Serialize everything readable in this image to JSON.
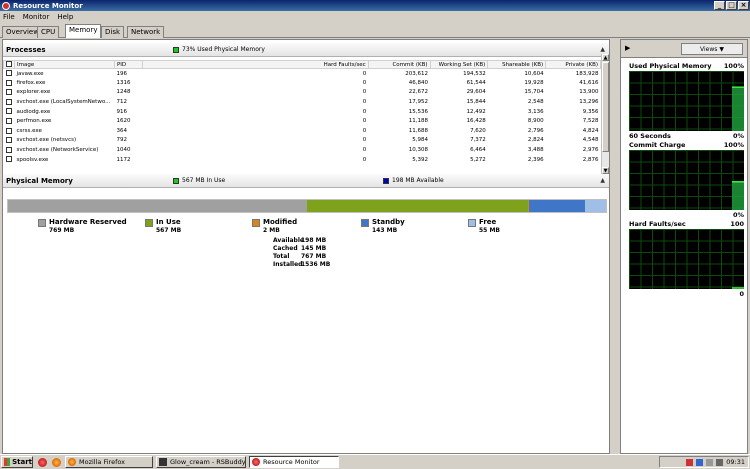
{
  "window": {
    "title": "Resource Monitor"
  },
  "menu": [
    "File",
    "Monitor",
    "Help"
  ],
  "tabs": [
    "Overview",
    "CPU",
    "Memory",
    "Disk",
    "Network"
  ],
  "active_tab": "Memory",
  "processes": {
    "label": "Processes",
    "legend": "73% Used Physical Memory",
    "legend_color": "#21c721",
    "columns": [
      "Image",
      "PID",
      "Hard Faults/sec",
      "Commit (KB)",
      "Working Set (KB)",
      "Shareable (KB)",
      "Private (KB)"
    ],
    "rows": [
      [
        "javaw.exe",
        "196",
        "0",
        "203,612",
        "194,532",
        "10,604",
        "183,928"
      ],
      [
        "firefox.exe",
        "1316",
        "0",
        "46,840",
        "61,544",
        "19,928",
        "41,616"
      ],
      [
        "explorer.exe",
        "1248",
        "0",
        "22,672",
        "29,604",
        "15,704",
        "13,900"
      ],
      [
        "svchost.exe (LocalSystemNetwo...",
        "712",
        "0",
        "17,952",
        "15,844",
        "2,548",
        "13,296"
      ],
      [
        "audiodg.exe",
        "916",
        "0",
        "15,536",
        "12,492",
        "3,136",
        "9,356"
      ],
      [
        "perfmon.exe",
        "1620",
        "0",
        "11,188",
        "16,428",
        "8,900",
        "7,528"
      ],
      [
        "csrss.exe",
        "364",
        "0",
        "11,688",
        "7,620",
        "2,796",
        "4,824"
      ],
      [
        "svchost.exe (netsvcs)",
        "792",
        "0",
        "5,984",
        "7,372",
        "2,824",
        "4,548"
      ],
      [
        "svchost.exe (NetworkService)",
        "1040",
        "0",
        "10,308",
        "6,464",
        "3,488",
        "2,976"
      ],
      [
        "spoolsv.exe",
        "1172",
        "0",
        "5,392",
        "5,272",
        "2,396",
        "2,876"
      ]
    ]
  },
  "physical_memory": {
    "label": "Physical Memory",
    "inuse_legend": "567 MB In Use",
    "inuse_color": "#21c721",
    "avail_legend": "198 MB Available",
    "avail_color": "#0000c0",
    "segments": [
      {
        "name": "Hardware Reserved",
        "value": "769 MB",
        "mb": 769,
        "color": "#a0a0a0"
      },
      {
        "name": "In Use",
        "value": "567 MB",
        "mb": 567,
        "color": "#7fa21d"
      },
      {
        "name": "Modified",
        "value": "2 MB",
        "mb": 2,
        "color": "#d6861d"
      },
      {
        "name": "Standby",
        "value": "143 MB",
        "mb": 143,
        "color": "#3f76c8"
      },
      {
        "name": "Free",
        "value": "55 MB",
        "mb": 55,
        "color": "#9fbfe6"
      }
    ],
    "stats": [
      {
        "k": "Available",
        "v": "198 MB"
      },
      {
        "k": "Cached",
        "v": "145 MB"
      },
      {
        "k": "Total",
        "v": "767 MB"
      },
      {
        "k": "Installed",
        "v": "1536 MB"
      }
    ]
  },
  "side": {
    "views_label": "Views",
    "graphs": [
      {
        "title": "Used Physical Memory",
        "max": "100%",
        "foot_left": "60 Seconds",
        "foot_right": "0%",
        "level": 0.73
      },
      {
        "title": "Commit Charge",
        "max": "100%",
        "foot_left": "",
        "foot_right": "0%",
        "level": 0.47
      },
      {
        "title": "Hard Faults/sec",
        "max": "100",
        "foot_left": "",
        "foot_right": "0",
        "level": 0.0
      }
    ]
  },
  "taskbar": {
    "start": "Start",
    "tasks": [
      "Mozilla Firefox",
      "Glow_cream - RSBuddy 1...",
      "Resource Monitor"
    ],
    "clock": "09:31"
  }
}
